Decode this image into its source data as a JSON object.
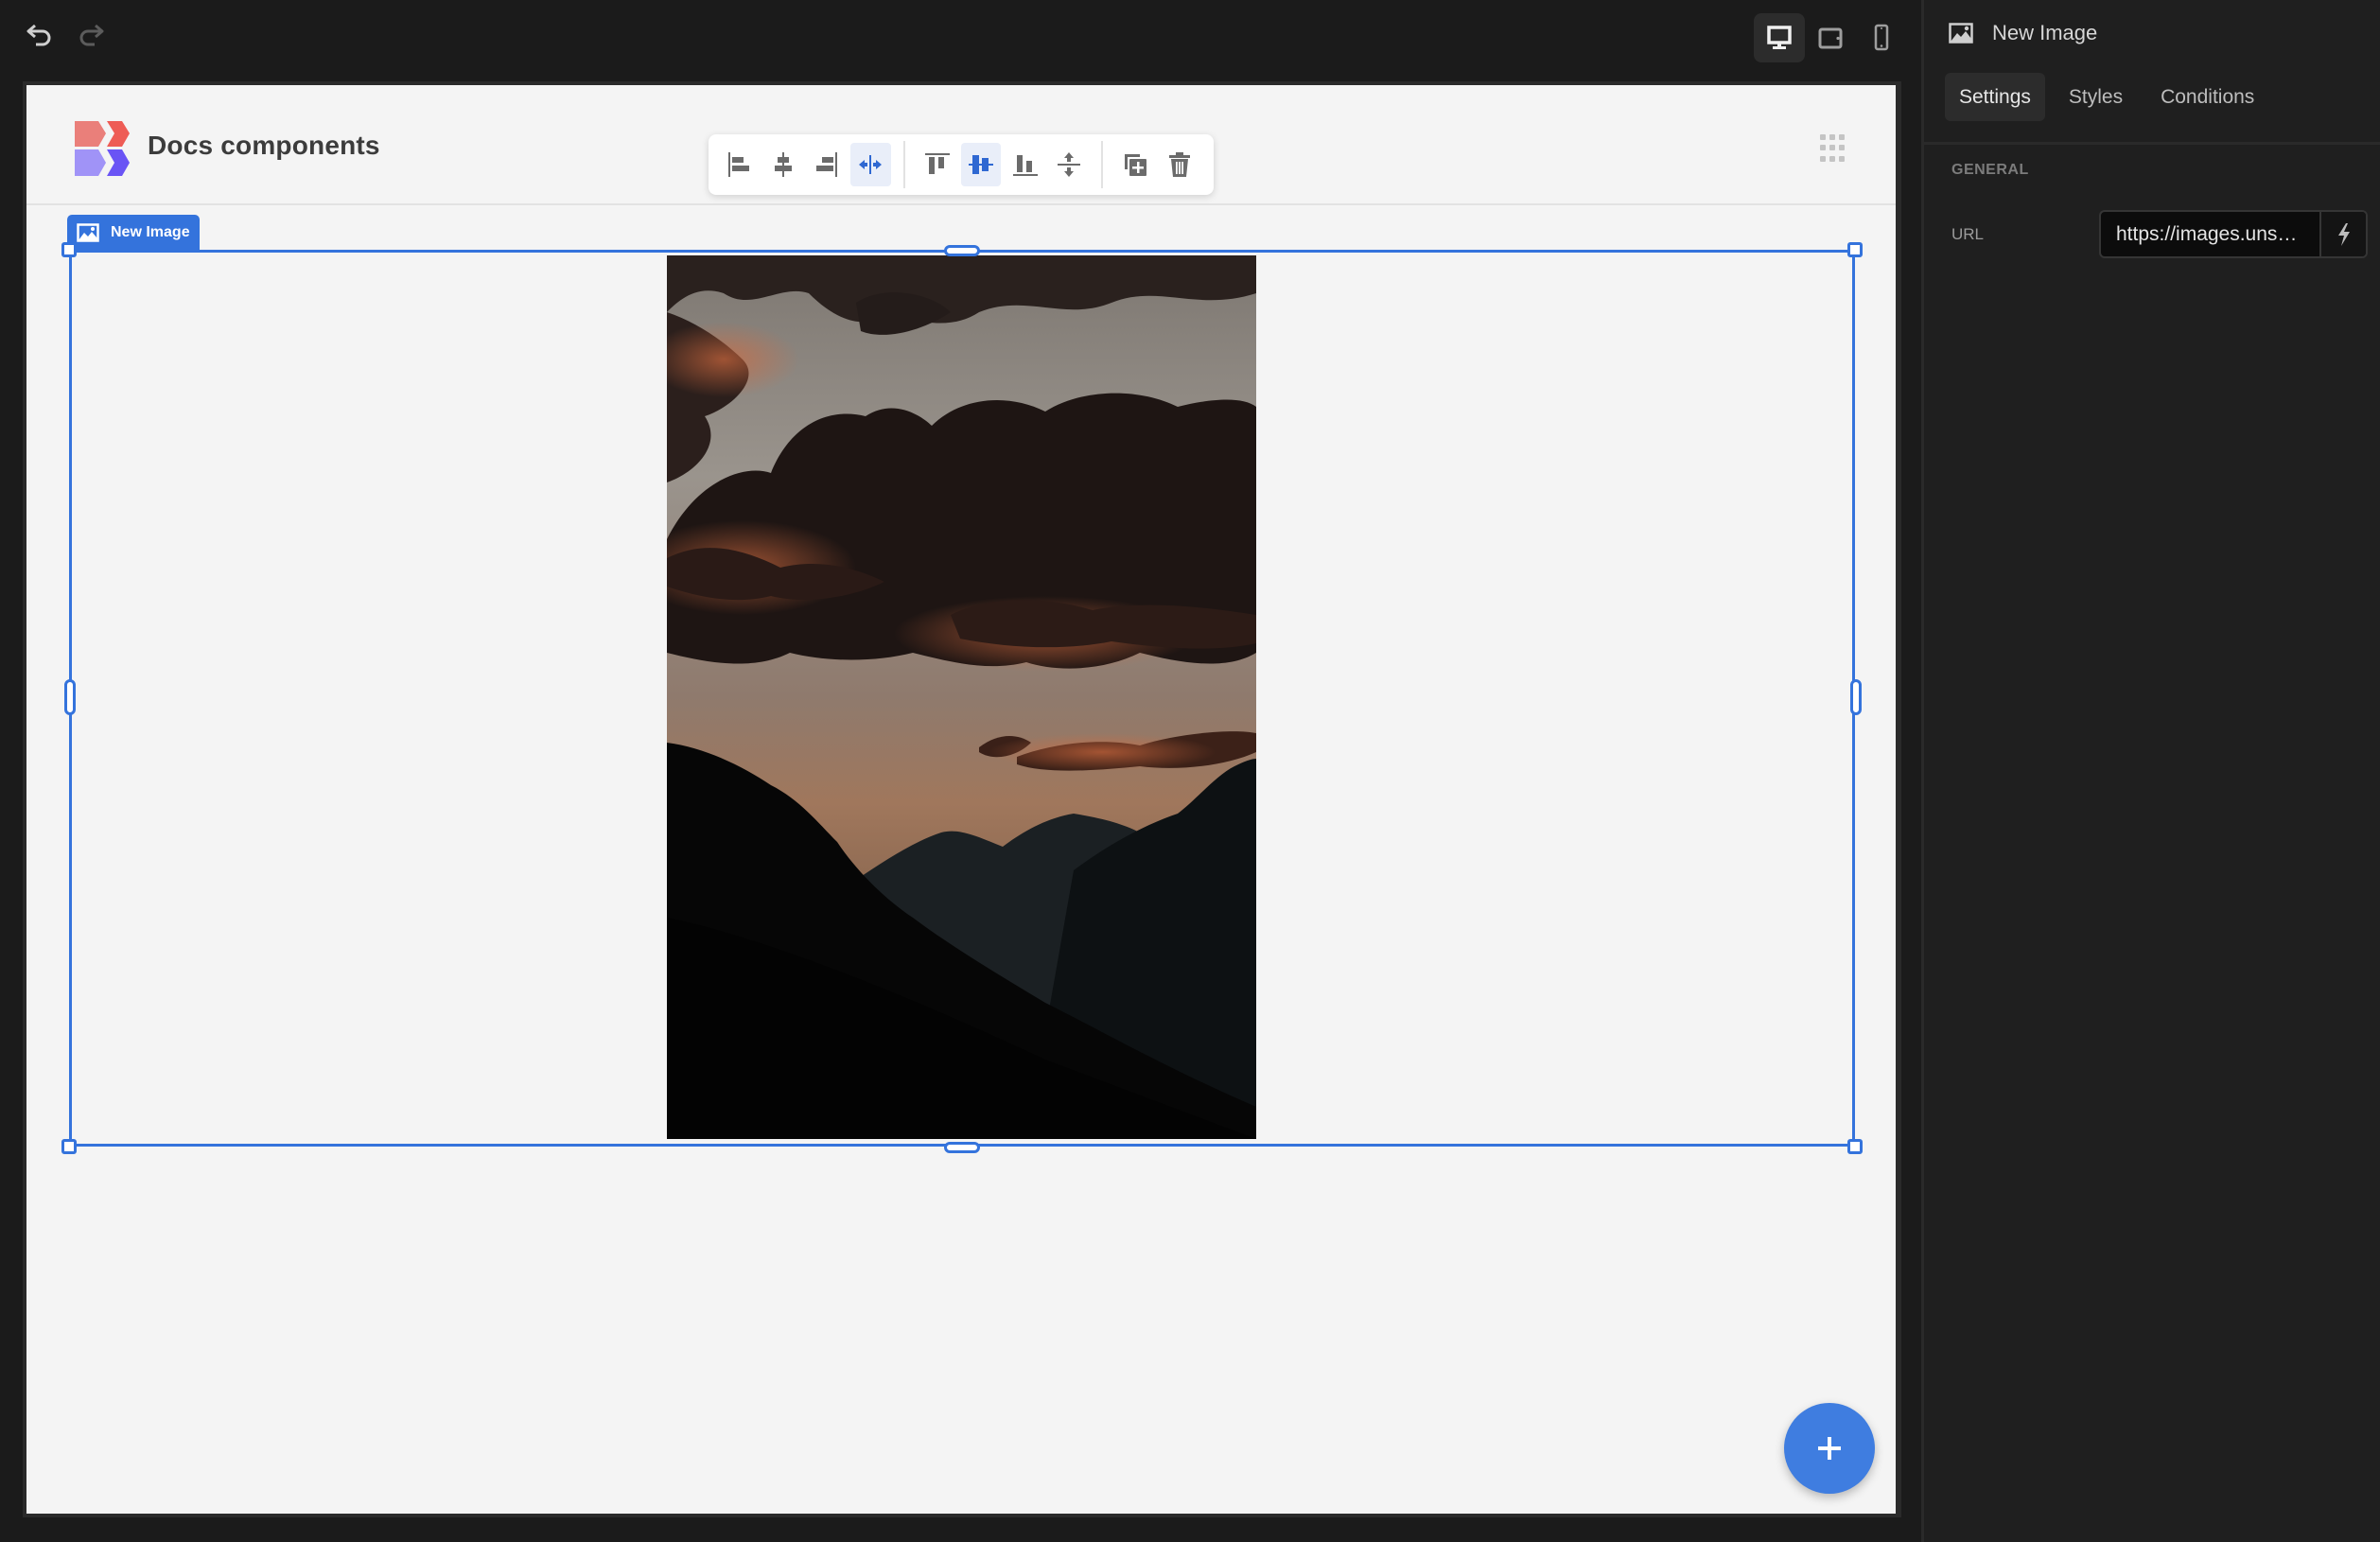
{
  "topbar": {
    "undo_icon": "undo-icon",
    "redo_icon": "redo-icon",
    "devices": [
      {
        "name": "desktop",
        "icon": "desktop-icon",
        "active": true
      },
      {
        "name": "tablet",
        "icon": "tablet-icon",
        "active": false
      },
      {
        "name": "mobile",
        "icon": "mobile-icon",
        "active": false
      }
    ]
  },
  "canvas": {
    "site_title": "Docs components",
    "logo": "logo-icon",
    "menu_icon": "grid-dots-icon",
    "floating_toolbar": {
      "groups": [
        [
          {
            "name": "align-left",
            "active": false
          },
          {
            "name": "align-center-horizontal",
            "active": false
          },
          {
            "name": "align-right",
            "active": false
          },
          {
            "name": "stretch-horizontal",
            "active": true
          }
        ],
        [
          {
            "name": "align-top",
            "active": false
          },
          {
            "name": "align-center-vertical",
            "active": true
          },
          {
            "name": "align-bottom",
            "active": false
          },
          {
            "name": "stretch-vertical",
            "active": false
          }
        ],
        [
          {
            "name": "duplicate",
            "active": false
          },
          {
            "name": "delete",
            "active": false
          }
        ]
      ]
    },
    "selection": {
      "label": "New Image",
      "icon": "image-icon"
    },
    "image_alt": "Sunset over mountain silhouettes with dark clouds",
    "fab_label": "+"
  },
  "panel": {
    "title": "New Image",
    "title_icon": "image-icon",
    "tabs": [
      {
        "label": "Settings",
        "active": true
      },
      {
        "label": "Styles",
        "active": false
      },
      {
        "label": "Conditions",
        "active": false
      }
    ],
    "section": "GENERAL",
    "fields": {
      "url": {
        "label": "URL",
        "value": "https://images.uns…",
        "action_icon": "bolt-icon"
      }
    }
  },
  "colors": {
    "accent": "#3473dc",
    "fab": "#3f7de0",
    "app_bg": "#1b1b1b",
    "panel_bg": "#1f1f1f",
    "canvas_bg": "#f4f4f4",
    "logo_red_light": "#ea7f7a",
    "logo_red": "#ee5c55",
    "logo_purple_light": "#a093f7",
    "logo_purple": "#6a54f5"
  }
}
